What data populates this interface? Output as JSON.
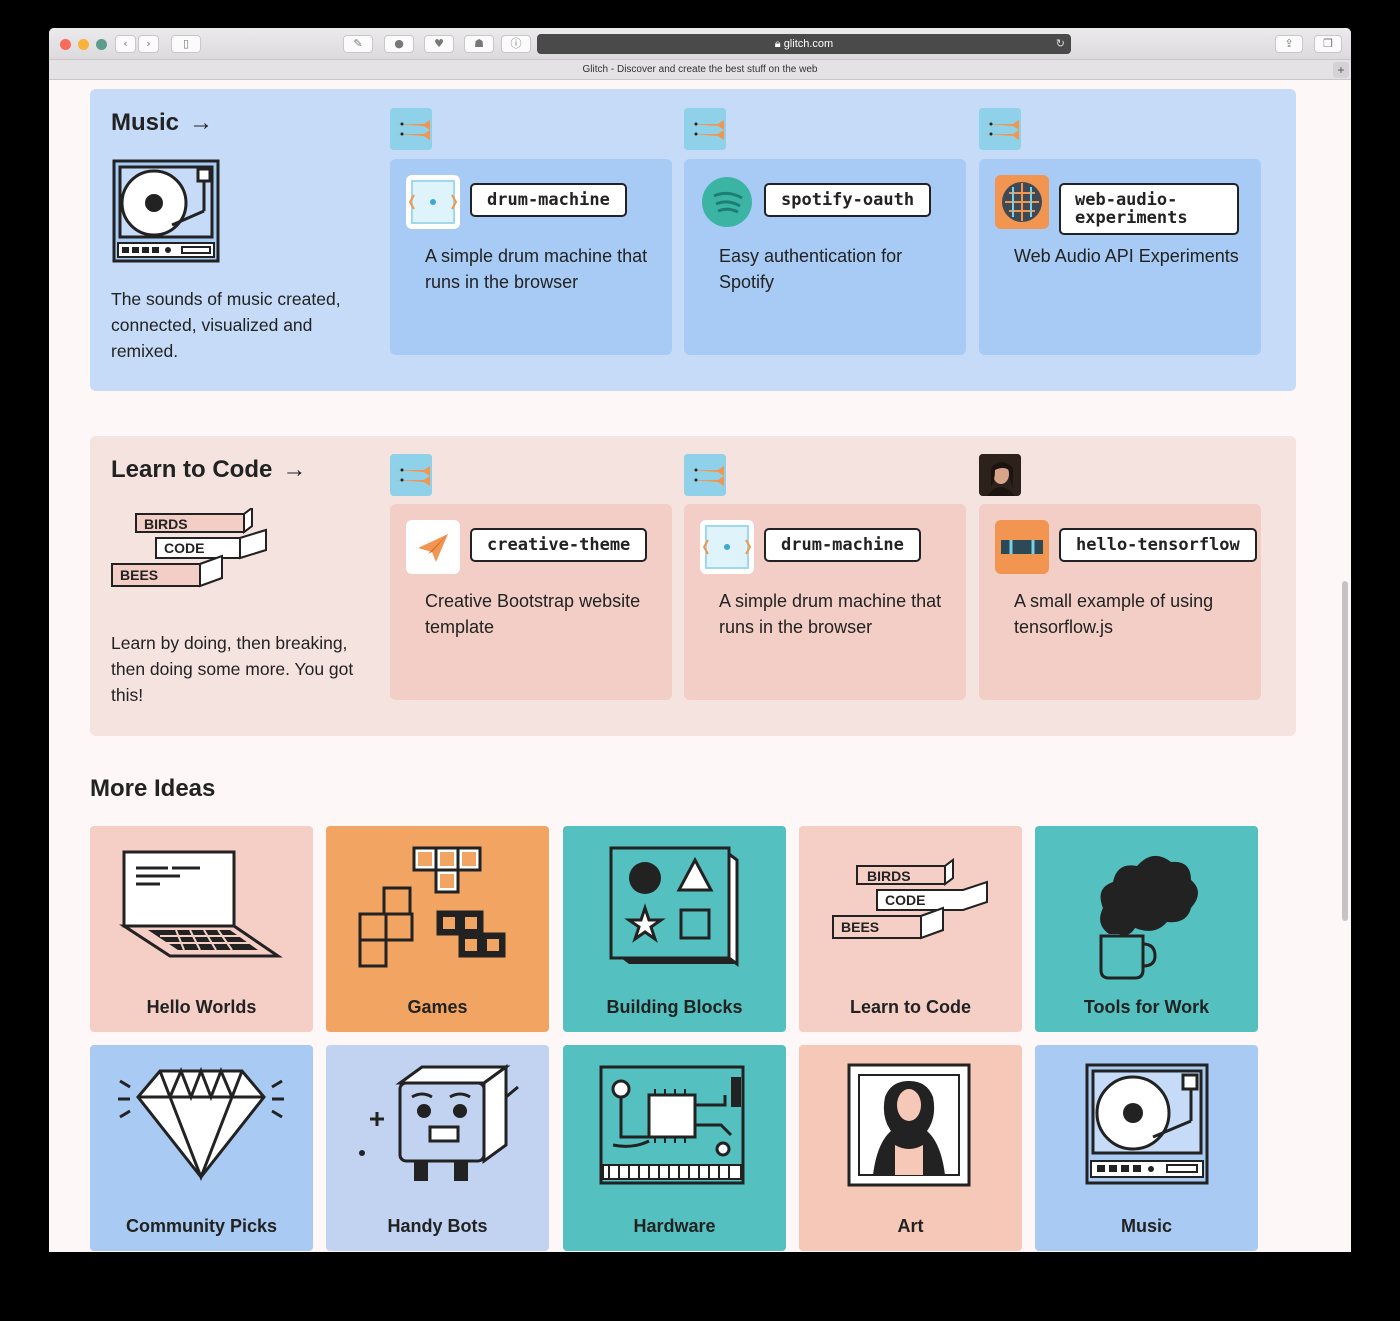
{
  "browser": {
    "url": "glitch.com",
    "tab_title": "Glitch - Discover and create the best stuff on the web"
  },
  "sections": [
    {
      "title": "Music",
      "arrow": "→",
      "description": "The sounds of music created, connected, visualized and remixed.",
      "projects": [
        {
          "name": "drum-machine",
          "description": "A simple drum machine that runs in the browser"
        },
        {
          "name": "spotify-oauth",
          "description": "Easy authentication for Spotify"
        },
        {
          "name": "web-audio-experiments",
          "description": "Web Audio API Experiments"
        }
      ]
    },
    {
      "title": "Learn to Code",
      "arrow": "→",
      "description": "Learn by doing, then breaking, then doing some more. You got this!",
      "illustration_labels": [
        "BIRDS",
        "CODE",
        "BEES"
      ],
      "projects": [
        {
          "name": "creative-theme",
          "description": "Creative Bootstrap website template"
        },
        {
          "name": "drum-machine",
          "description": "A simple drum machine that runs in the browser"
        },
        {
          "name": "hello-tensorflow",
          "description": "A small example of using tensorflow.js"
        }
      ]
    }
  ],
  "more_ideas": {
    "title": "More Ideas",
    "tiles": [
      {
        "label": "Hello Worlds",
        "color": "#f5cfc6"
      },
      {
        "label": "Games",
        "color": "#f2a562"
      },
      {
        "label": "Building Blocks",
        "color": "#54c0c0"
      },
      {
        "label": "Learn to Code",
        "color": "#f5cfc6"
      },
      {
        "label": "Tools for Work",
        "color": "#54c0c0"
      },
      {
        "label": "Community Picks",
        "color": "#a9cbf3"
      },
      {
        "label": "Handy Bots",
        "color": "#c2d3f2"
      },
      {
        "label": "Hardware",
        "color": "#54c0c0"
      },
      {
        "label": "Art",
        "color": "#f6c8b7"
      },
      {
        "label": "Music",
        "color": "#a9cbf3"
      }
    ],
    "learn_labels": [
      "BIRDS",
      "CODE",
      "BEES"
    ]
  }
}
